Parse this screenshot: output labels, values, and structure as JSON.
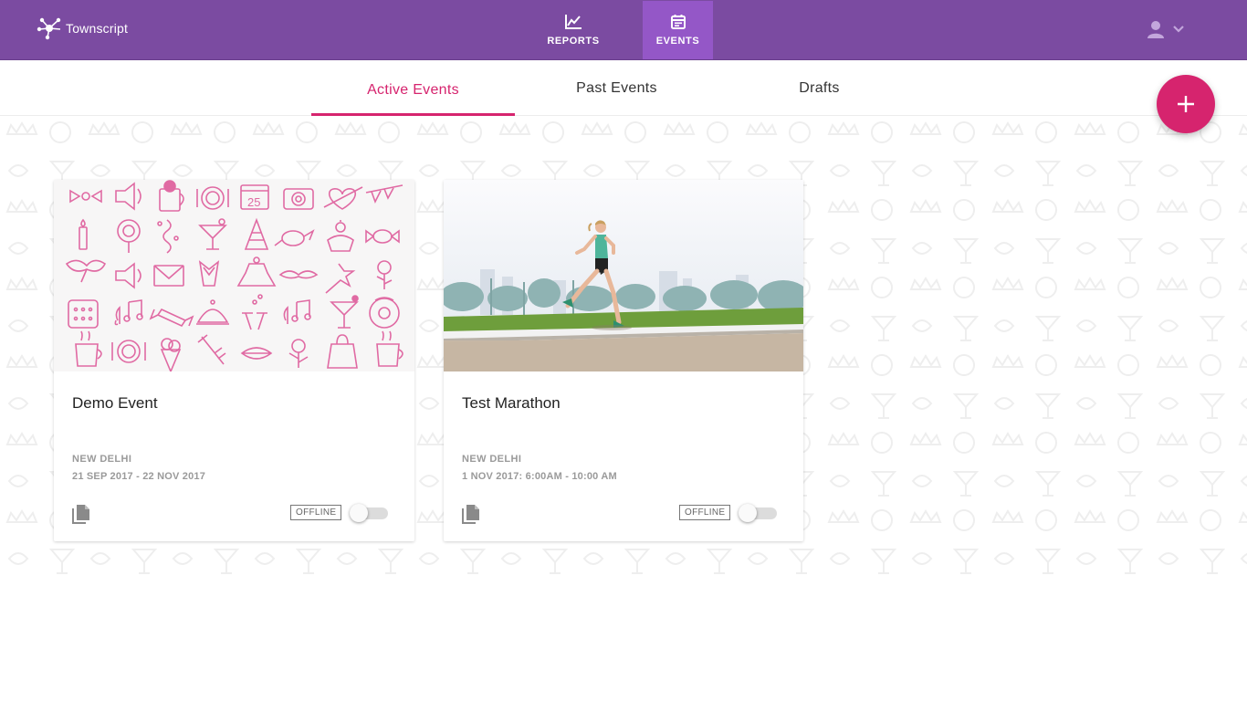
{
  "app": {
    "brand": "Townscript"
  },
  "nav": {
    "reports_label": "REPORTS",
    "events_label": "EVENTS",
    "active": "events"
  },
  "tabs": [
    {
      "label": "Active Events",
      "active": true
    },
    {
      "label": "Past Events",
      "active": false
    },
    {
      "label": "Drafts",
      "active": false
    }
  ],
  "fab": {
    "icon": "plus-icon"
  },
  "events": [
    {
      "title": "Demo Event",
      "location": "NEW DELHI",
      "dates": "21 SEP 2017 - 22 NOV 2017",
      "status_badge": "OFFLINE",
      "toggle_on": false,
      "image": "party-icons-pattern"
    },
    {
      "title": "Test Marathon",
      "location": "NEW DELHI",
      "dates": "1 NOV 2017: 6:00AM - 10:00 AM",
      "status_badge": "OFFLINE",
      "toggle_on": false,
      "image": "runner-photo"
    }
  ],
  "colors": {
    "header": "#7b4ba1",
    "nav_active": "#9457c7",
    "accent": "#d6246e",
    "pattern_icon": "#e06aa3"
  },
  "icons": [
    "townscript-logo-icon",
    "chart-line-icon",
    "calendar-icon",
    "user-icon",
    "chevron-down-icon",
    "plus-icon",
    "document-icon"
  ]
}
